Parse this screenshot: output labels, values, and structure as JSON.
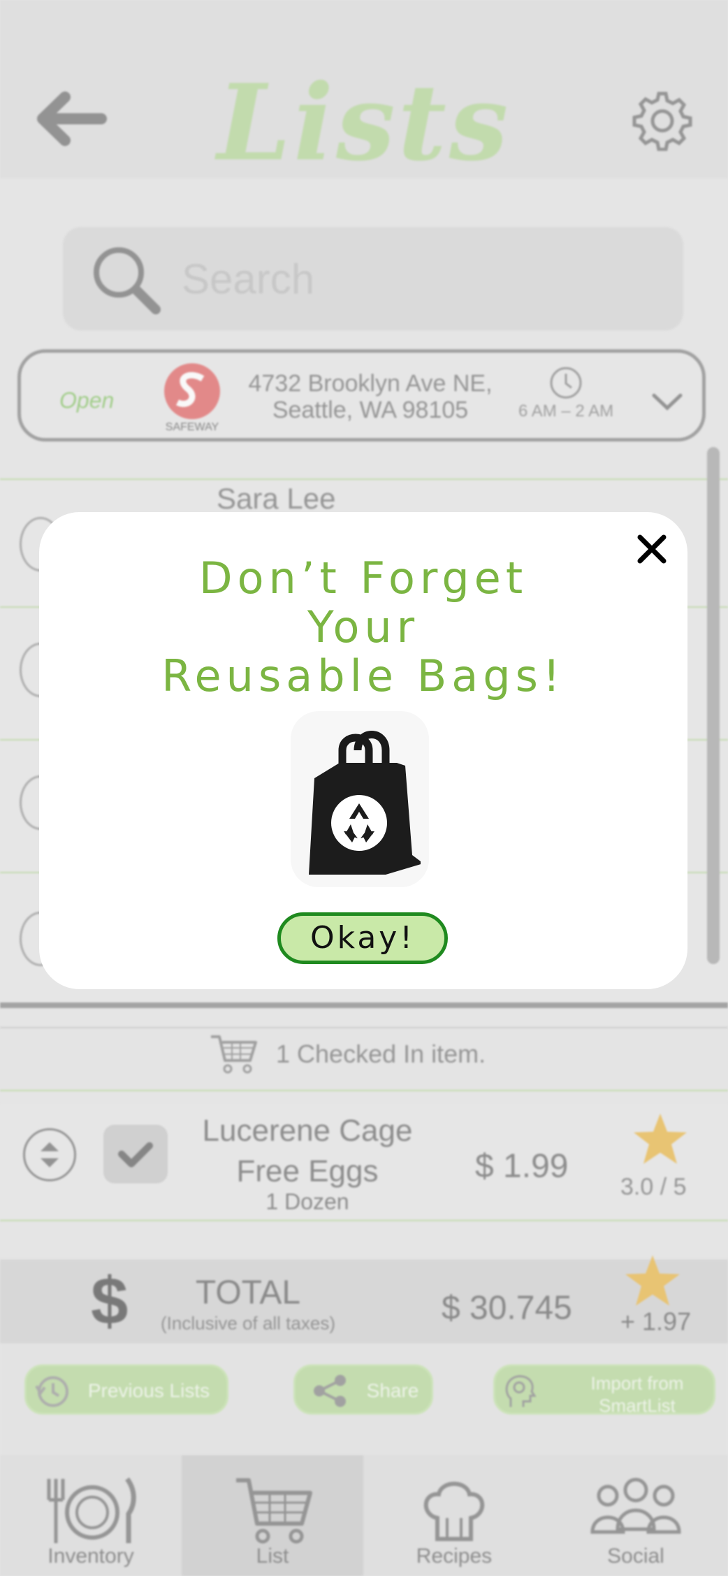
{
  "header": {
    "title": "Lists",
    "back_icon": "back-arrow-icon",
    "settings_icon": "gear-icon"
  },
  "search": {
    "placeholder": "Search"
  },
  "store": {
    "status": "Open",
    "logo_text": "SAFEWAY",
    "address_line1": "4732 Brooklyn Ave NE,",
    "address_line2": "Seattle, WA 98105",
    "hours": "6 AM – 2 AM"
  },
  "list": {
    "visible_item_name": "Sara Lee"
  },
  "checked_in": {
    "label": "1 Checked In item."
  },
  "checked_item": {
    "name_line1": "Lucerene Cage",
    "name_line2": "Free Eggs",
    "quantity": "1 Dozen",
    "price": "$ 1.99",
    "rating": "3.0 / 5",
    "checked": true
  },
  "total": {
    "symbol": "$",
    "label": "TOTAL",
    "sublabel": "(Inclusive of all taxes)",
    "amount": "$ 30.745",
    "bonus": "+ 1.97"
  },
  "actions": {
    "previous_lists": "Previous Lists",
    "share": "Share",
    "import_line1": "Import from",
    "import_line2": "SmartList"
  },
  "nav": {
    "items": [
      {
        "label": "Inventory",
        "icon": "plate-cutlery-icon"
      },
      {
        "label": "List",
        "icon": "cart-icon",
        "active": true
      },
      {
        "label": "Recipes",
        "icon": "chef-hat-icon"
      },
      {
        "label": "Social",
        "icon": "people-icon"
      }
    ]
  },
  "modal": {
    "title_line1": "Don’t Forget",
    "title_line2": "Your",
    "title_line3": "Reusable Bags!",
    "button_label": "Okay!",
    "close_icon": "close-icon",
    "image_icon": "reusable-bag-icon"
  },
  "colors": {
    "accent_green": "#7bb542",
    "button_border": "#1f8a1f",
    "button_fill": "#c9e9a8",
    "star": "#e9b23c"
  }
}
